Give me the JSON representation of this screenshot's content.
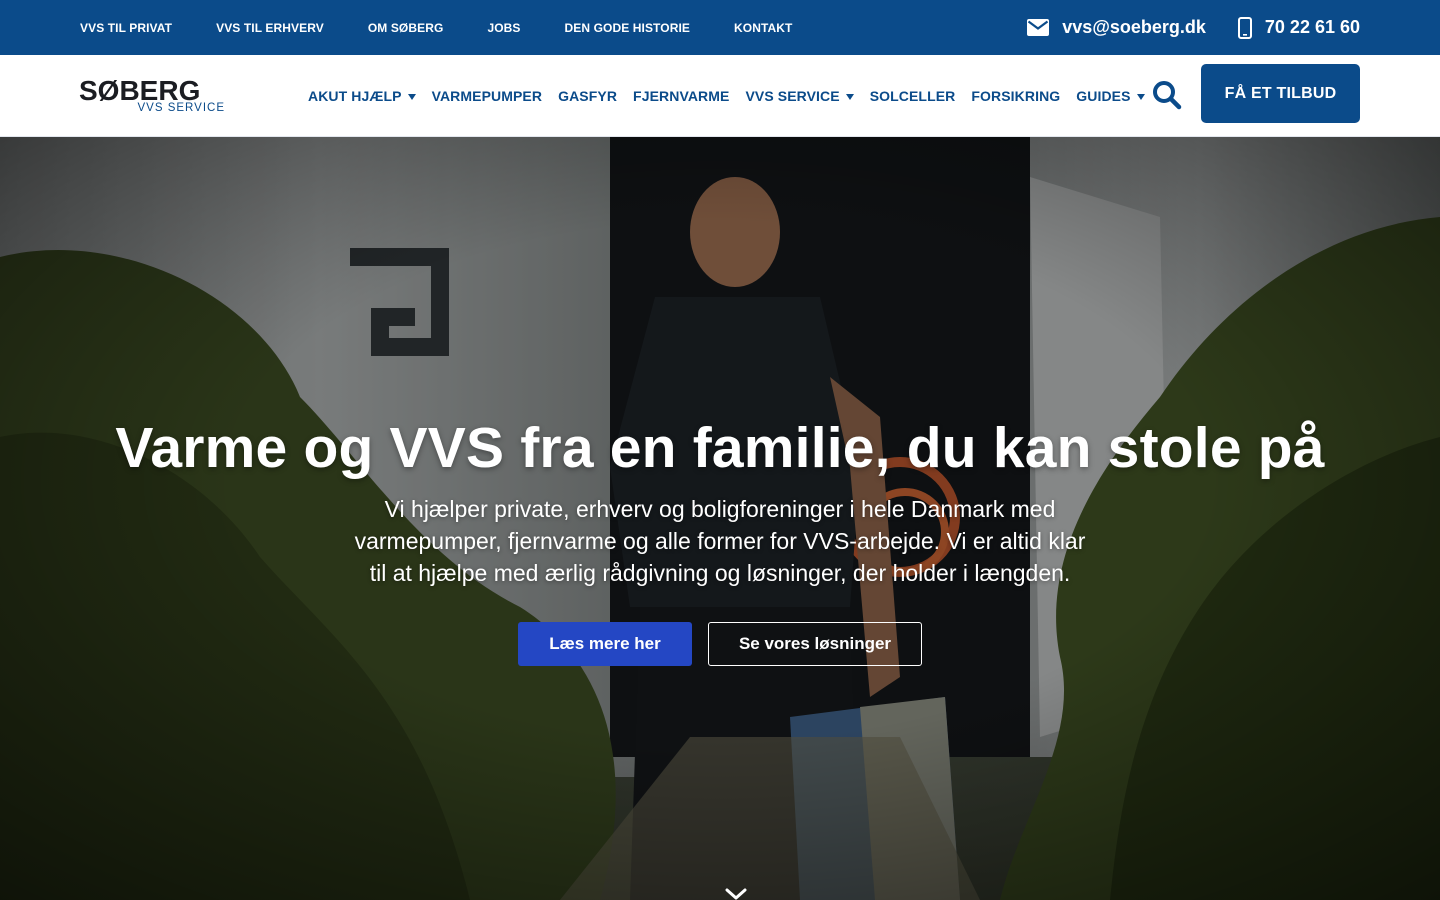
{
  "topbar": {
    "links": [
      "VVS TIL PRIVAT",
      "VVS TIL ERHVERV",
      "OM SØBERG",
      "JOBS",
      "DEN GODE HISTORIE",
      "KONTAKT"
    ],
    "email": "vvs@soeberg.dk",
    "phone": "70 22 61 60",
    "email_icon": "envelope-icon",
    "phone_icon": "mobile-phone-icon"
  },
  "header": {
    "logo": {
      "wordmark": "SØBERG",
      "tagline": "VVS SERVICE"
    },
    "nav": [
      {
        "label": "AKUT HJÆLP",
        "dropdown": true
      },
      {
        "label": "VARMEPUMPER",
        "dropdown": false
      },
      {
        "label": "GASFYR",
        "dropdown": false
      },
      {
        "label": "FJERNVARME",
        "dropdown": false
      },
      {
        "label": "VVS SERVICE",
        "dropdown": true
      },
      {
        "label": "SOLCELLER",
        "dropdown": false
      },
      {
        "label": "FORSIKRING",
        "dropdown": false
      },
      {
        "label": "GUIDES",
        "dropdown": true
      }
    ],
    "search_icon": "search-icon",
    "cta_label": "FÅ ET TILBUD"
  },
  "hero": {
    "title": "Varme og VVS fra en familie, du kan stole på",
    "text_lines": [
      "Vi hjælper private, erhverv og boligforeninger i hele Danmark med",
      "varmepumper, fjernvarme og alle former for VVS-arbejde. Vi er altid klar",
      "til at hjælpe med ærlig rådgivning og løsninger, der holder i længden."
    ],
    "primary_button": "Læs mere her",
    "secondary_button": "Se vores løsninger",
    "scroll_icon": "chevron-down-icon"
  },
  "colors": {
    "brand_blue": "#0b4b8a",
    "primary_button": "#2447c4",
    "text_light": "#ffffff"
  }
}
